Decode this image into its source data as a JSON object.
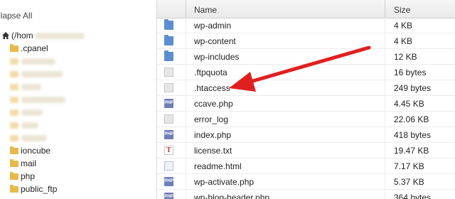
{
  "tree": {
    "collapse_label": "llapse All",
    "home_label": "(/hom",
    "items": [
      {
        "label": ".cpanel"
      },
      {
        "label": "ioncube"
      },
      {
        "label": "mail"
      },
      {
        "label": "php"
      },
      {
        "label": "public_ftp"
      }
    ]
  },
  "table": {
    "col_name": "Name",
    "col_size": "Size",
    "rows": [
      {
        "name": "wp-admin",
        "size": "4 KB",
        "icon": "folder-icon"
      },
      {
        "name": "wp-content",
        "size": "4 KB",
        "icon": "folder-icon"
      },
      {
        "name": "wp-includes",
        "size": "12 KB",
        "icon": "folder-icon"
      },
      {
        "name": ".ftpquota",
        "size": "16 bytes",
        "icon": "file-icon"
      },
      {
        "name": ".htaccess",
        "size": "249 bytes",
        "icon": "file-icon"
      },
      {
        "name": "ccave.php",
        "size": "4.45 KB",
        "icon": "php-file-icon"
      },
      {
        "name": "error_log",
        "size": "22.06 KB",
        "icon": "file-icon"
      },
      {
        "name": "index.php",
        "size": "418 bytes",
        "icon": "php-file-icon"
      },
      {
        "name": "license.txt",
        "size": "19.47 KB",
        "icon": "text-file-icon"
      },
      {
        "name": "readme.html",
        "size": "7.17 KB",
        "icon": "html-file-icon"
      },
      {
        "name": "wp-activate.php",
        "size": "5.37 KB",
        "icon": "php-file-icon"
      },
      {
        "name": "wp-blog-header.php",
        "size": "364 bytes",
        "icon": "php-file-icon"
      }
    ]
  },
  "annotation": {
    "arrow_color": "#e02020"
  }
}
